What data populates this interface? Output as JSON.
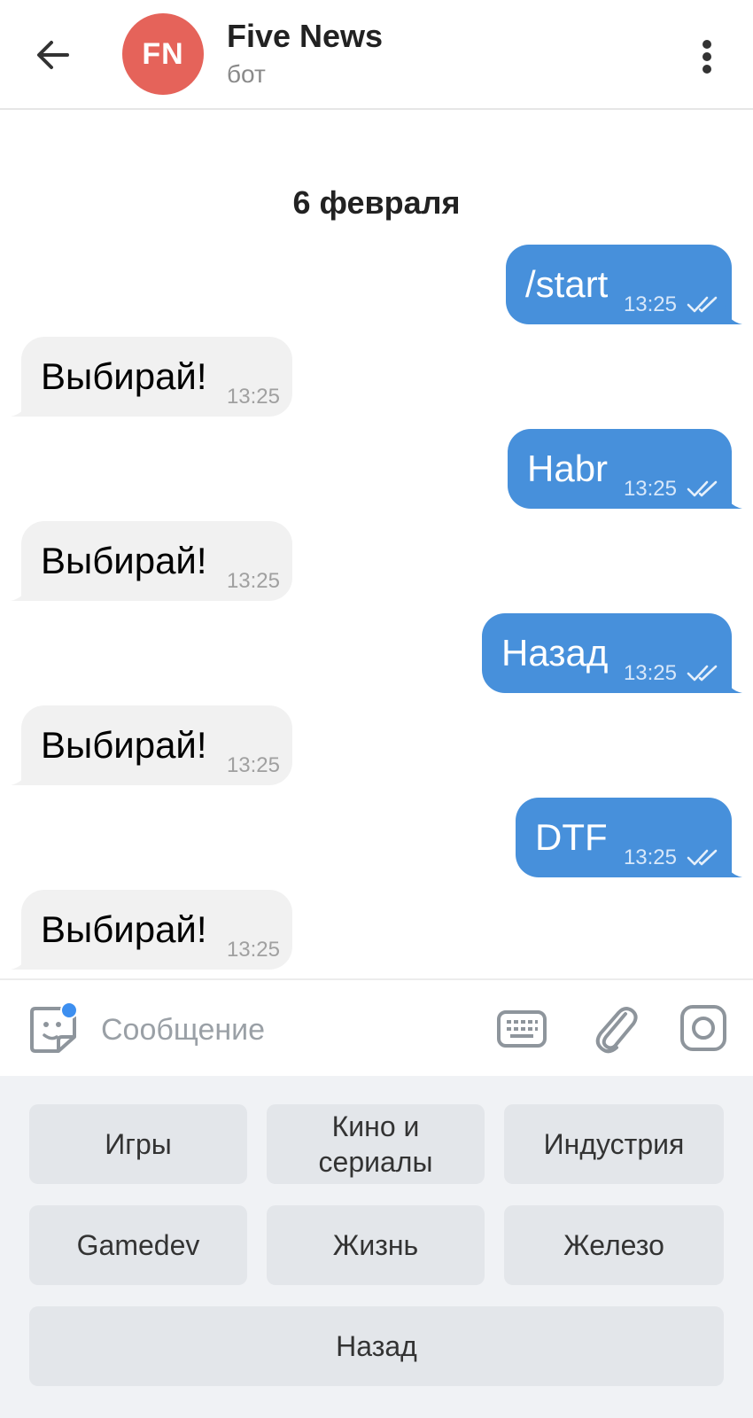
{
  "header": {
    "avatar_initials": "FN",
    "avatar_color": "#e5635a",
    "title": "Five News",
    "subtitle": "бот",
    "back_icon": "arrow-left-icon",
    "menu_icon": "more-vertical-icon"
  },
  "chat": {
    "date_label": "6 февраля",
    "messages": [
      {
        "direction": "out",
        "text": "/start",
        "time": "13:25",
        "status": "read"
      },
      {
        "direction": "in",
        "text": "Выбирай!",
        "time": "13:25"
      },
      {
        "direction": "out",
        "text": "Habr",
        "time": "13:25",
        "status": "read"
      },
      {
        "direction": "in",
        "text": "Выбирай!",
        "time": "13:25"
      },
      {
        "direction": "out",
        "text": "Назад",
        "time": "13:25",
        "status": "read"
      },
      {
        "direction": "in",
        "text": "Выбирай!",
        "time": "13:25"
      },
      {
        "direction": "out",
        "text": "DTF",
        "time": "13:25",
        "status": "read"
      },
      {
        "direction": "in",
        "text": "Выбирай!",
        "time": "13:25"
      }
    ]
  },
  "input": {
    "placeholder": "Сообщение",
    "value": ""
  },
  "keyboard": {
    "rows": [
      [
        "Игры",
        "Кино и сериалы",
        "Индустрия"
      ],
      [
        "Gamedev",
        "Жизнь",
        "Железо"
      ],
      [
        "Назад"
      ]
    ]
  },
  "colors": {
    "outgoing_bubble": "#4790db",
    "incoming_bubble": "#f1f1f1",
    "keyboard_bg": "#f0f2f5",
    "keyboard_button": "#e3e6ea",
    "accent_dot": "#3d8ff0"
  }
}
